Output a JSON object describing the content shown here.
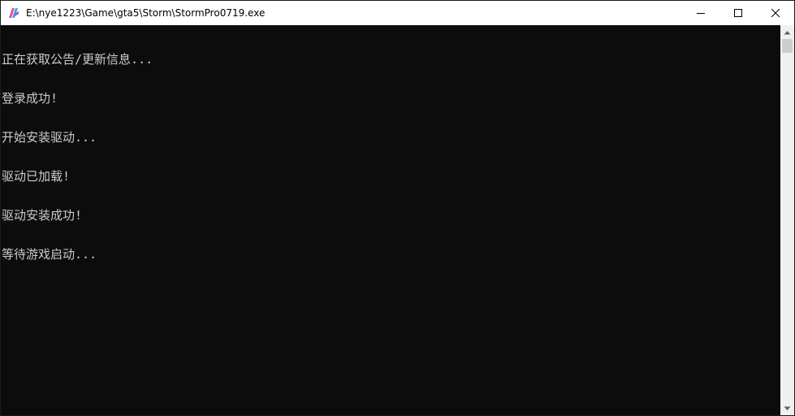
{
  "window": {
    "title": "E:\\nye1223\\Game\\gta5\\Storm\\StormPro0719.exe",
    "app_icon": "storm-app-icon",
    "caption_buttons": [
      "minimize-icon",
      "maximize-icon",
      "close-icon"
    ]
  },
  "console": {
    "background": "#0c0c0c",
    "foreground": "#cccccc",
    "lines": [
      "正在获取公告/更新信息...",
      "登录成功!",
      "开始安装驱动...",
      "驱动已加载!",
      "驱动安装成功!",
      "等待游戏启动..."
    ]
  },
  "scrollbar": {
    "icons": [
      "scroll-up-icon",
      "scroll-down-icon"
    ]
  }
}
